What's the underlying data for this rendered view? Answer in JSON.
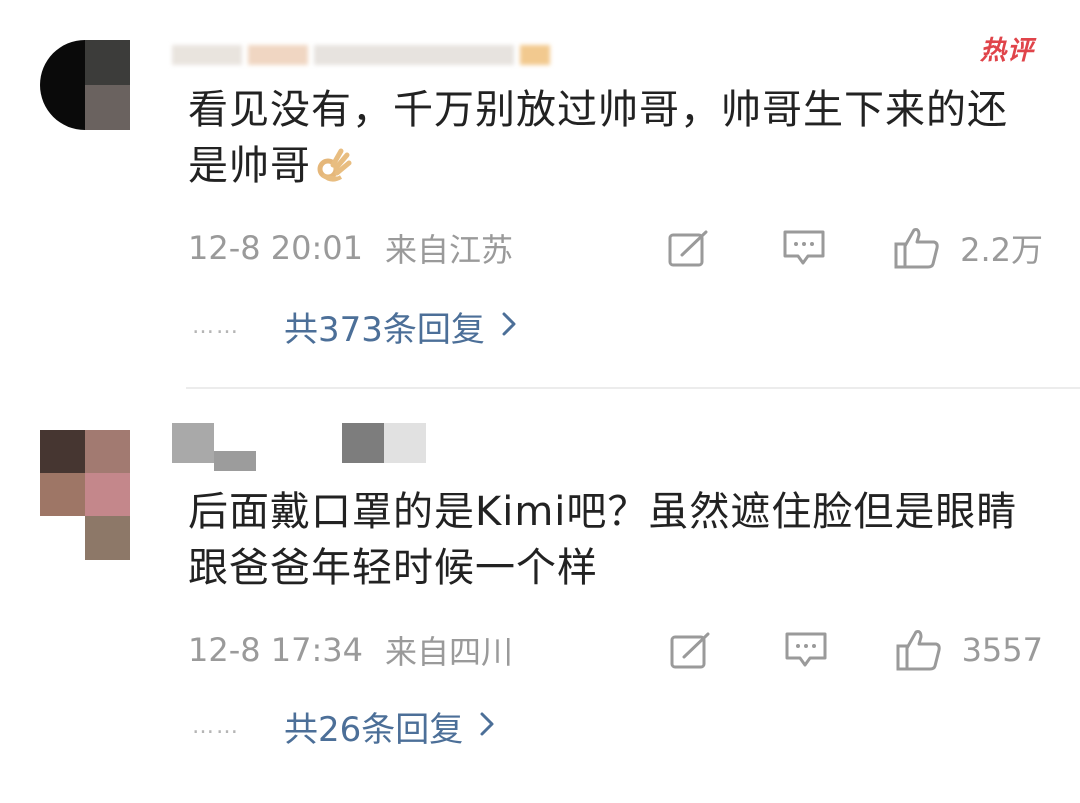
{
  "comments": [
    {
      "badge": "热评",
      "text": "看见没有，千万别放过帅哥，帅哥生下来的还是帅哥",
      "emoji": "ok-hand-emoji",
      "time": "12-8 20:01",
      "location": "来自江苏",
      "likes": "2.2万",
      "replies_label": "共373条回复",
      "dots": "……"
    },
    {
      "text": "后面戴口罩的是Kimi吧？虽然遮住脸但是眼睛跟爸爸年轻时候一个样",
      "time": "12-8 17:34",
      "location": "来自四川",
      "likes": "3557",
      "replies_label": "共26条回复",
      "dots": "……"
    }
  ],
  "icons": {
    "repost": "repost-icon",
    "comment": "comment-icon",
    "like": "thumbs-up-icon",
    "chevron": "chevron-right-icon"
  },
  "colors": {
    "link": "#4c6f98",
    "meta": "#9a9a9a",
    "hot_badge": "#e0444a",
    "text": "#222222",
    "divider": "#ececec"
  }
}
